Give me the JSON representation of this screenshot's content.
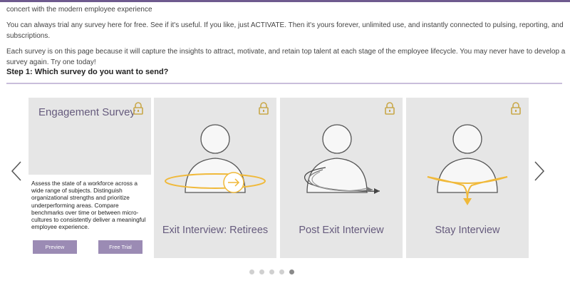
{
  "intro": {
    "line1": "concert with the modern employee experience",
    "line2": "You can always trial any survey here for free. See if it's useful. If you like, just ACTIVATE. Then it's yours forever, unlimited use, and instantly connected to pulsing, reporting, and subscriptions.",
    "line3": "Each survey is on this page because it will capture the insights to attract, motivate, and retain top talent at each stage of the employee lifecycle. You may never have to develop a survey again. Try one today!"
  },
  "step": {
    "label": "Step 1:",
    "question": "Which survey do you want to send?"
  },
  "cards": [
    {
      "title": "Engagement Survey",
      "description": "Assess the state of a workforce across a wide range of subjects. Distinguish organizational strengths and prioritize underperforming areas. Compare benchmarks over time or between micro-cultures to consistently deliver a meaningful employee experience.",
      "preview_label": "Preview",
      "trial_label": "Free Trial"
    },
    {
      "title": "Exit Interview: Retirees"
    },
    {
      "title": "Post Exit Interview"
    },
    {
      "title": "Stay Interview"
    }
  ],
  "pagination": {
    "total": 5,
    "active": 4
  },
  "colors": {
    "accent": "#9b8bb4",
    "title": "#665b7d",
    "illustration_orange": "#f0b93a",
    "card_bg": "#e6e6e6"
  },
  "icons": {
    "lock": "lock-icon",
    "prev": "chevron-left-icon",
    "next": "chevron-right-icon"
  }
}
